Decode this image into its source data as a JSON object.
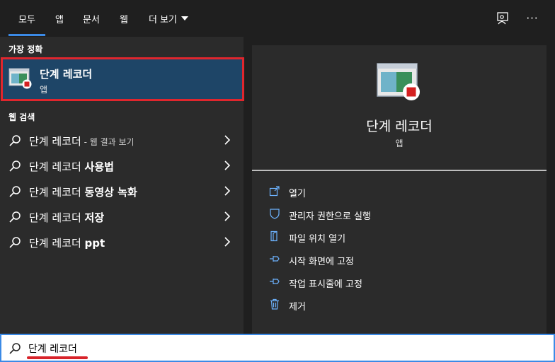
{
  "tabs": [
    {
      "label": "모두",
      "active": true
    },
    {
      "label": "앱"
    },
    {
      "label": "문서"
    },
    {
      "label": "웹"
    },
    {
      "label": "더 보기"
    }
  ],
  "top_icons": [
    "feedback-icon",
    "more-options-icon"
  ],
  "more_label": "···",
  "best_match": {
    "section_label": "가장 정확",
    "title": "단계 레코더",
    "type": "앱"
  },
  "web_search": {
    "section_label": "웹 검색",
    "items": [
      {
        "prefix": "단계 레코더",
        "bold": "",
        "suffix": " - 웹 결과 보기"
      },
      {
        "prefix": "단계 레코더 ",
        "bold": "사용법",
        "suffix": ""
      },
      {
        "prefix": "단계 레코더 ",
        "bold": "동영상 녹화",
        "suffix": ""
      },
      {
        "prefix": "단계 레코더 ",
        "bold": "저장",
        "suffix": ""
      },
      {
        "prefix": "단계 레코더 ",
        "bold": "ppt",
        "suffix": ""
      }
    ]
  },
  "preview": {
    "title": "단계 레코더",
    "type": "앱",
    "actions": [
      {
        "label": "열기",
        "icon": "open-icon"
      },
      {
        "label": "관리자 권한으로 실행",
        "icon": "shield-icon"
      },
      {
        "label": "파일 위치 열기",
        "icon": "file-location-icon"
      },
      {
        "label": "시작 화면에 고정",
        "icon": "pin-icon"
      },
      {
        "label": "작업 표시줄에 고정",
        "icon": "pin-icon"
      },
      {
        "label": "제거",
        "icon": "trash-icon"
      }
    ]
  },
  "search": {
    "value": "단계 레코더"
  },
  "colors": {
    "accent": "#3b8ae6",
    "highlight_border": "#e0262d",
    "selected_bg": "#1e4567"
  }
}
